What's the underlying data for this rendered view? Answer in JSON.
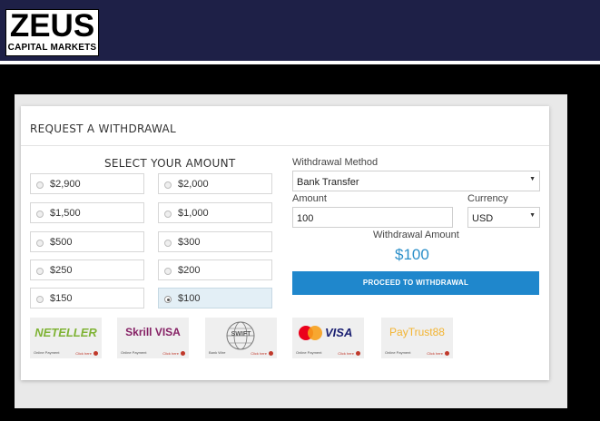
{
  "logo": {
    "main": "ZEUS",
    "sub": "CAPITAL MARKETS"
  },
  "card": {
    "title": "REQUEST A WITHDRAWAL"
  },
  "amounts": {
    "title": "SELECT YOUR AMOUNT",
    "options": [
      "$2,900",
      "$2,000",
      "$1,500",
      "$1,000",
      "$500",
      "$300",
      "$250",
      "$200",
      "$150",
      "$100"
    ],
    "selected": "$100"
  },
  "form": {
    "method_label": "Withdrawal Method",
    "method_value": "Bank Transfer",
    "amount_label": "Amount",
    "amount_value": "100",
    "currency_label": "Currency",
    "currency_value": "USD",
    "withdrawal_amount_label": "Withdrawal Amount",
    "withdrawal_amount_value": "$100",
    "proceed_label": "PROCEED TO WITHDRAWAL"
  },
  "payment_methods": [
    {
      "brand": "NETELLER",
      "caption": "Online Payment",
      "help": "Click here"
    },
    {
      "brand": "Skrill VISA",
      "caption": "Online Payment",
      "help": "Click here"
    },
    {
      "brand": "SWIFT",
      "caption": "Bank Wire",
      "help": "Click here"
    },
    {
      "brand": "VISA",
      "caption": "Online Payment",
      "help": "Click here"
    },
    {
      "brand": "PayTrust88",
      "caption": "Online Payment",
      "help": "Click here"
    }
  ],
  "colors": {
    "header": "#1e2047",
    "accent": "#1f87cc",
    "amount_text": "#2b8fc9",
    "neteller": "#7fb335",
    "skrill": "#862165",
    "visa": "#1a1f71",
    "paytrust": "#f3b431"
  }
}
